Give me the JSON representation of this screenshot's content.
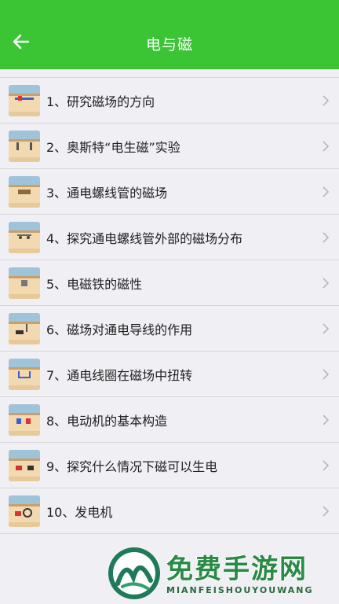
{
  "header": {
    "title": "电与磁",
    "back_icon": "back-arrow-icon",
    "background": "#3bc535"
  },
  "list": [
    {
      "label": "1、研究磁场的方向"
    },
    {
      "label": "2、奥斯特“电生磁”实验"
    },
    {
      "label": "3、通电螺线管的磁场"
    },
    {
      "label": "4、探究通电螺线管外部的磁场分布"
    },
    {
      "label": "5、电磁铁的磁性"
    },
    {
      "label": "6、磁场对通电导线的作用"
    },
    {
      "label": "7、通电线圈在磁场中扭转"
    },
    {
      "label": "8、电动机的基本构造"
    },
    {
      "label": "9、探究什么情况下磁可以生电"
    },
    {
      "label": "10、发电机"
    }
  ],
  "watermark": {
    "cn": "免费手游网",
    "en": "MIANFEISHOUYOUWANG"
  }
}
